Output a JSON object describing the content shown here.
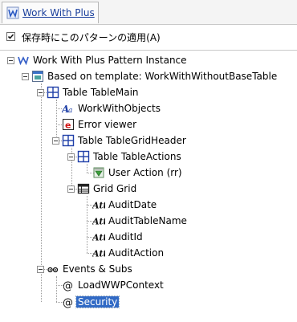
{
  "tab": {
    "label": "Work With Plus"
  },
  "option": {
    "checked": true,
    "label": "保存時にこのパターンの適用(A)"
  },
  "tree": {
    "root": "Work With Plus Pattern Instance",
    "template": "Based on template: WorkWithWithoutBaseTable",
    "table_main": "Table TableMain",
    "work_with_objects": "WorkWithObjects",
    "error_viewer": "Error viewer",
    "grid_header": "Table TableGridHeader",
    "table_actions": "Table TableActions",
    "user_action": "User Action (rr)",
    "grid": "Grid Grid",
    "attributes": [
      "AuditDate",
      "AuditTableName",
      "AuditId",
      "AuditAction"
    ],
    "events": "Events & Subs",
    "load_context": "LoadWWPContext",
    "security": "Security"
  },
  "colors": {
    "selection": "#316ac5",
    "tab_text": "#1a3f9c"
  }
}
